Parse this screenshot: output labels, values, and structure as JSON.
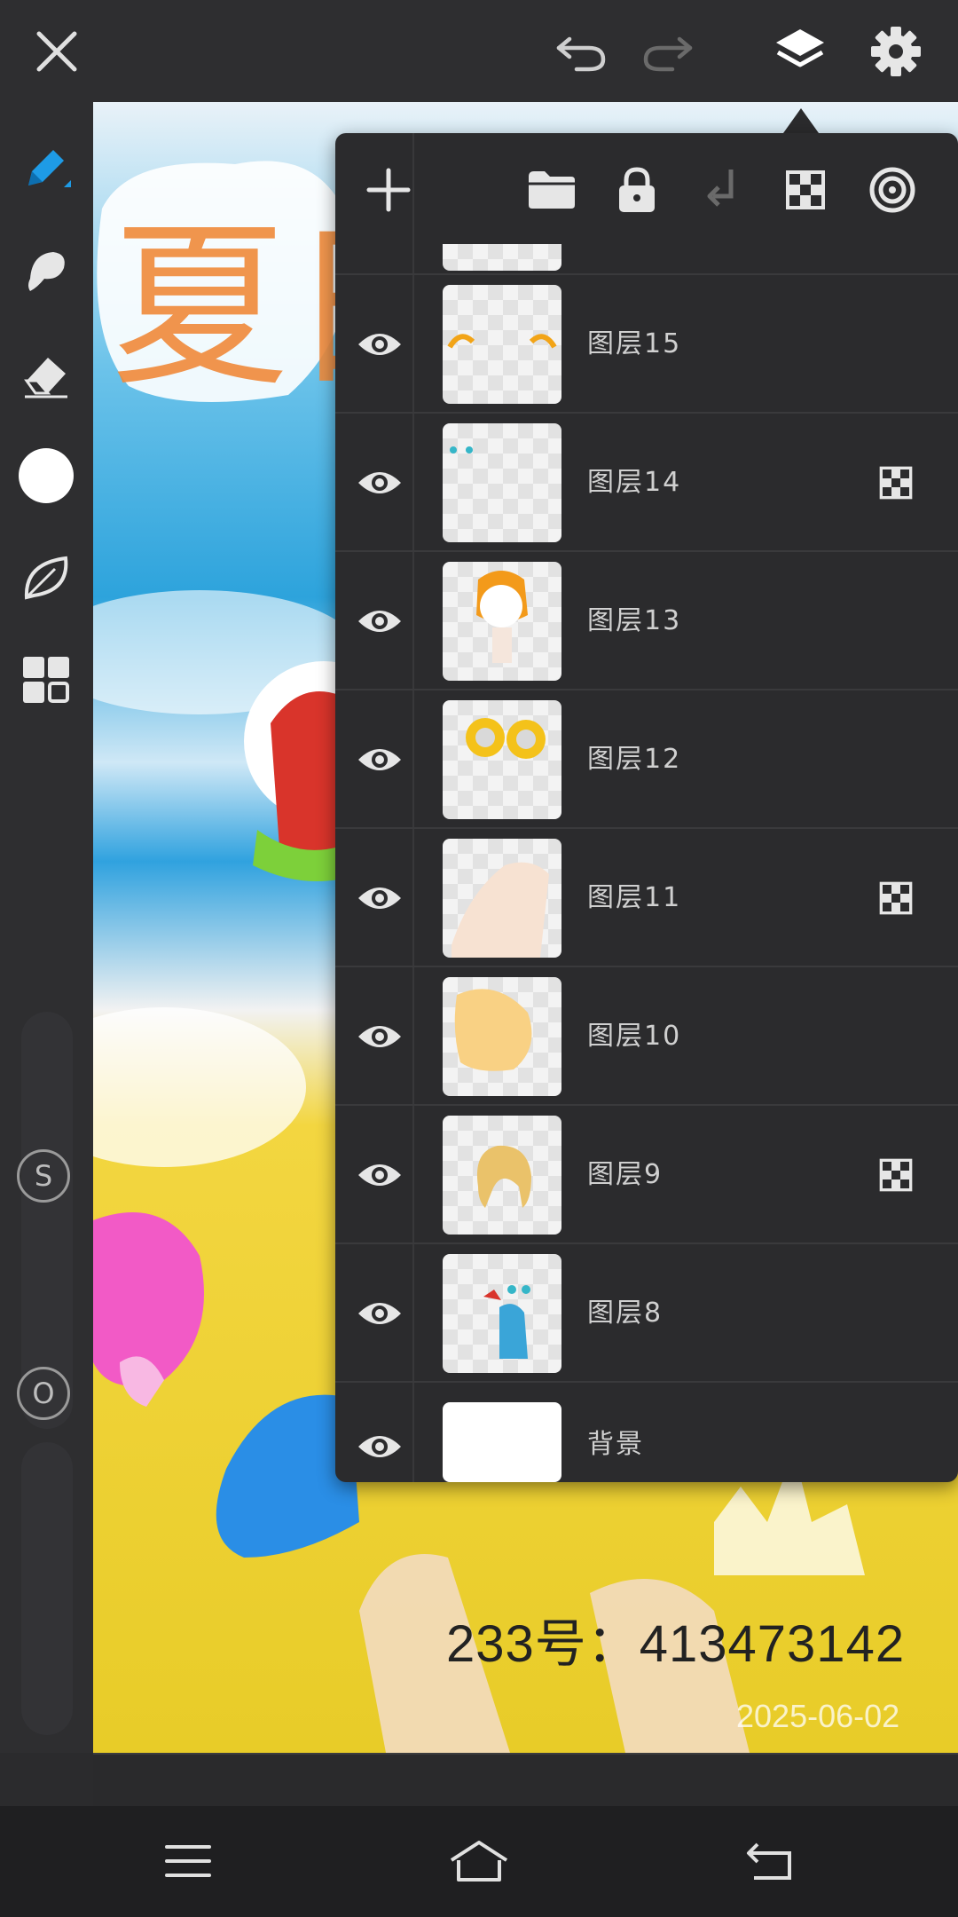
{
  "topbar": {
    "close": "close-icon",
    "undo": "undo-icon",
    "redo": "redo-icon",
    "layers": "layers-icon",
    "settings": "gear-icon"
  },
  "leftbar": {
    "tools": [
      "pen-icon",
      "smudge-icon",
      "eraser-icon",
      "color-swatch",
      "leaf-icon",
      "grid-icon"
    ],
    "brush_size_label": "S",
    "opacity_label": "O",
    "active_color": "#ffffff",
    "accent": "#1e9be6"
  },
  "canvas": {
    "stamp_text": "233号：413473142",
    "date_text": "2025-06-02"
  },
  "layer_panel": {
    "toolbar": [
      "add-layer-icon",
      "folder-icon",
      "lock-icon",
      "merge-down-icon",
      "alpha-lock-icon",
      "clip-mask-icon"
    ],
    "layers": [
      {
        "name": "图层15",
        "alpha_locked": false
      },
      {
        "name": "图层14",
        "alpha_locked": true
      },
      {
        "name": "图层13",
        "alpha_locked": false
      },
      {
        "name": "图层12",
        "alpha_locked": false
      },
      {
        "name": "图层11",
        "alpha_locked": true
      },
      {
        "name": "图层10",
        "alpha_locked": false
      },
      {
        "name": "图层9",
        "alpha_locked": true
      },
      {
        "name": "图层8",
        "alpha_locked": false
      },
      {
        "name": "背景",
        "alpha_locked": false
      }
    ]
  },
  "sysnav": {
    "menu": "menu-icon",
    "home": "home-icon",
    "back": "back-icon"
  }
}
